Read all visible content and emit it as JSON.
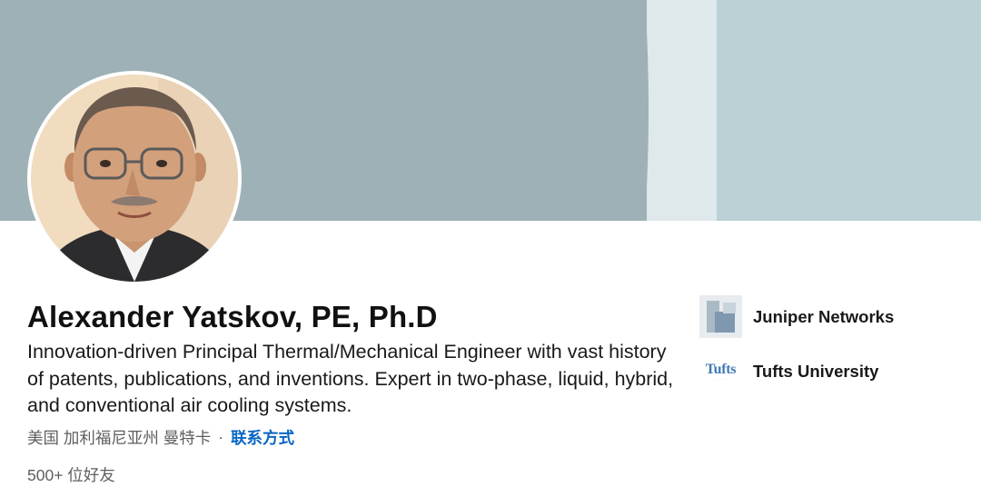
{
  "profile": {
    "name": "Alexander Yatskov, PE, Ph.D",
    "headline": "Innovation-driven Principal Thermal/Mechanical Engineer with vast history of patents, publications, and inventions. Expert in two-phase, liquid, hybrid, and conventional air cooling systems.",
    "location": "美国 加利福尼亚州 曼特卡",
    "separator": "·",
    "contact_link": "联系方式",
    "connections": "500+ 位好友"
  },
  "affiliations": [
    {
      "name": "Juniper Networks",
      "logo": "juniper-logo"
    },
    {
      "name": "Tufts University",
      "logo": "tufts-logo",
      "logo_text": "Tufts"
    }
  ],
  "colors": {
    "banner_dark": "#9eb1b6",
    "banner_light": "#dfe8eb",
    "banner_right": "#bcd1d6",
    "link_blue": "#0a66c2",
    "muted_text": "#5e5e5e"
  }
}
